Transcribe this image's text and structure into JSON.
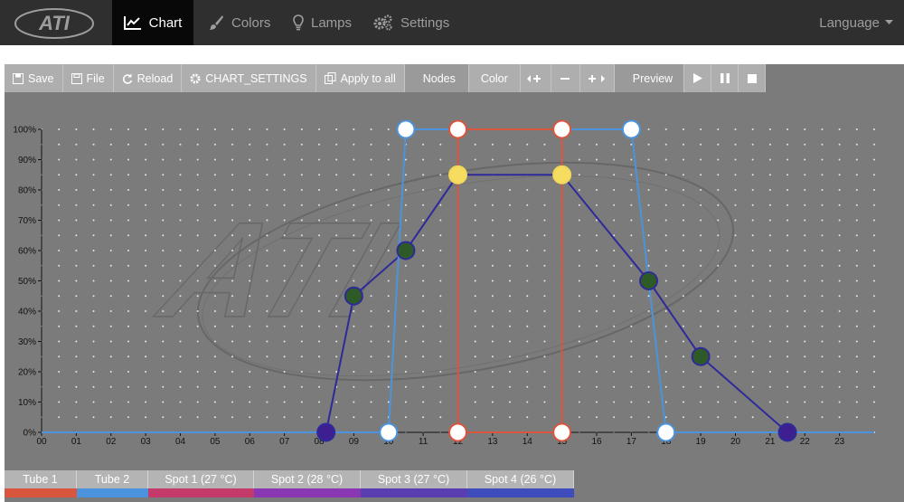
{
  "nav": {
    "brand": "ATI",
    "items": [
      {
        "label": "Chart",
        "active": true,
        "icon": "line-chart-icon"
      },
      {
        "label": "Colors",
        "active": false,
        "icon": "paintbrush-icon"
      },
      {
        "label": "Lamps",
        "active": false,
        "icon": "lightbulb-icon"
      },
      {
        "label": "Settings",
        "active": false,
        "icon": "gears-icon"
      }
    ],
    "language": "Language"
  },
  "toolbar": {
    "save": "Save",
    "file": "File",
    "reload": "Reload",
    "chart_settings": "CHART_SETTINGS",
    "apply_all": "Apply to all",
    "nodes": "Nodes",
    "color": "Color",
    "preview": "Preview"
  },
  "tabs": [
    {
      "label": "Tube 1",
      "color": "#d9553d"
    },
    {
      "label": "Tube 2",
      "color": "#4b94dd"
    },
    {
      "label": "Spot 1 (27 °C)",
      "color": "#c43a6a"
    },
    {
      "label": "Spot 2 (28 °C)",
      "color": "#8a37b4"
    },
    {
      "label": "Spot 3 (27 °C)",
      "color": "#5a3db0"
    },
    {
      "label": "Spot 4 (26 °C)",
      "color": "#3e4cbc"
    }
  ],
  "chart_data": {
    "type": "line",
    "x_ticks": [
      "00",
      "01",
      "02",
      "03",
      "04",
      "05",
      "06",
      "07",
      "08",
      "09",
      "10",
      "11",
      "12",
      "13",
      "14",
      "15",
      "16",
      "17",
      "18",
      "19",
      "20",
      "21",
      "22",
      "23"
    ],
    "y_ticks": [
      "0%",
      "10%",
      "20%",
      "30%",
      "40%",
      "50%",
      "60%",
      "70%",
      "80%",
      "90%",
      "100%"
    ],
    "xlim": [
      0,
      24
    ],
    "ylim": [
      0,
      100
    ],
    "grid": true,
    "series": [
      {
        "color": "#2e2a9a",
        "marker": "#3d1f8f",
        "points": [
          [
            0,
            0
          ],
          [
            8.2,
            0
          ],
          [
            9,
            45
          ],
          [
            10.5,
            60
          ],
          [
            12,
            85
          ],
          [
            15,
            85
          ],
          [
            17.5,
            50
          ],
          [
            19,
            25
          ],
          [
            21.5,
            0
          ],
          [
            24,
            0
          ]
        ],
        "markers": [
          [
            8.2,
            0
          ],
          [
            9,
            45
          ],
          [
            10.5,
            60
          ],
          [
            17.5,
            50
          ],
          [
            19,
            25
          ],
          [
            21.5,
            0
          ]
        ],
        "marker_fills": [
          "#3d1f8f",
          "#2d5a27",
          "#2d5a27",
          "#2d5a27",
          "#2d5a27",
          "#3d1f8f"
        ]
      },
      {
        "color": "#4b94dd",
        "marker": "#ffffff",
        "points": [
          [
            0,
            0
          ],
          [
            10,
            0
          ],
          [
            10.5,
            100
          ],
          [
            17,
            100
          ],
          [
            18,
            0
          ],
          [
            24,
            0
          ]
        ],
        "markers": [
          [
            10,
            0
          ],
          [
            10.5,
            100
          ],
          [
            17,
            100
          ],
          [
            18,
            0
          ]
        ]
      },
      {
        "color": "#d9553d",
        "marker": "#ffffff",
        "points": [
          [
            12,
            0
          ],
          [
            12,
            100
          ],
          [
            15,
            100
          ],
          [
            15,
            0
          ],
          [
            12,
            0
          ]
        ],
        "markers": [
          [
            12,
            0
          ],
          [
            12,
            100
          ],
          [
            15,
            100
          ],
          [
            15,
            0
          ]
        ]
      },
      {
        "color": "#f2d75a",
        "marker": "#f7dd5f",
        "points": [],
        "markers": [
          [
            12,
            85
          ],
          [
            15,
            85
          ]
        ]
      }
    ]
  }
}
